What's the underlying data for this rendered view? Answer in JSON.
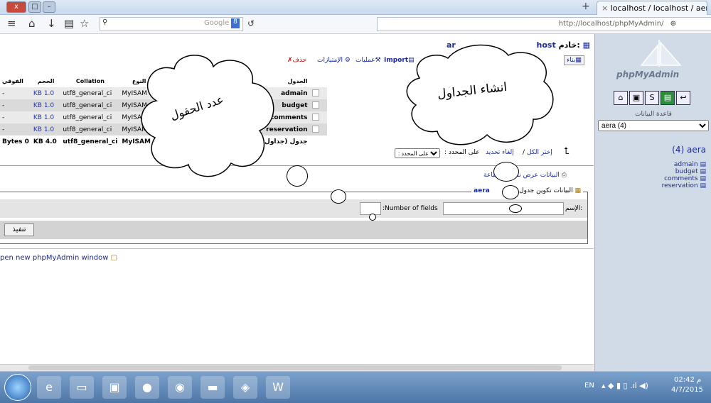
{
  "browser": {
    "tab_title": "localhost / localhost / aera ...",
    "search_engine": "Google",
    "url": "http://localhost/phpMyAdmin/",
    "window_minimize": "–",
    "window_restore": "□",
    "window_close": "x"
  },
  "server_header": {
    "label": "خادم:",
    "host": "host",
    "db_prefix": "ar"
  },
  "toolbar": {
    "drop": "حذف",
    "privileges": "الإمتيازات",
    "operations": "عمليات",
    "import": "Import",
    "structure": "بناء"
  },
  "table": {
    "columns": [
      "الجدول",
      "النوع",
      "Collation",
      "الحجم",
      "الفوقي"
    ],
    "rows": [
      {
        "name": "admain",
        "type": "MyISAM",
        "collation": "utf8_general_ci",
        "size": "KB 1.0",
        "overhead": "-"
      },
      {
        "name": "budget",
        "type": "MyISAM",
        "collation": "utf8_general_ci",
        "size": "KB 1.0",
        "overhead": "-"
      },
      {
        "name": "comments",
        "type": "MyISAM",
        "collation": "utf8_general_ci",
        "size": "KB 1.0",
        "overhead": "-"
      },
      {
        "name": "reservation",
        "type": "MyISAM",
        "collation": "utf8_general_ci",
        "size": "KB 1.0",
        "overhead": "-"
      }
    ],
    "summary": {
      "name": "4 جدول (جداول)",
      "type": "MyISAM",
      "collation": "utf8_general_ci",
      "size": "KB 4.0",
      "overhead": "Bytes 0"
    }
  },
  "selection": {
    "check_all": "إختر الكل",
    "uncheck_all": "إلغاء تحديد",
    "with_selected": ": على المحدد"
  },
  "links": {
    "print_view": "عرض نسخة للطباعة",
    "data_dictionary": "البيانات"
  },
  "create_table": {
    "legend_prefix": "تكوين جدول جديد",
    "legend_db": "aera",
    "legend_mid": "البيانات",
    "name_label": "الإسم:",
    "fields_label": ":Number of fields",
    "name_value": "",
    "fields_value": "",
    "submit": "تنفيذ"
  },
  "footer_link": "pen new phpMyAdmin window",
  "annotations": {
    "create_tables": "انشاء الجداول",
    "field_count": "عدد الحقول"
  },
  "sidebar": {
    "logo": "phpMyAdmin",
    "databases_label": "قاعدة البيانات",
    "db_select": "aera (4)",
    "db_title": "(4) aera",
    "tables": [
      "admain",
      "budget",
      "comments",
      "reservation"
    ]
  },
  "taskbar": {
    "lang": "EN",
    "time": "02:42 م",
    "date": "4/7/2015"
  }
}
